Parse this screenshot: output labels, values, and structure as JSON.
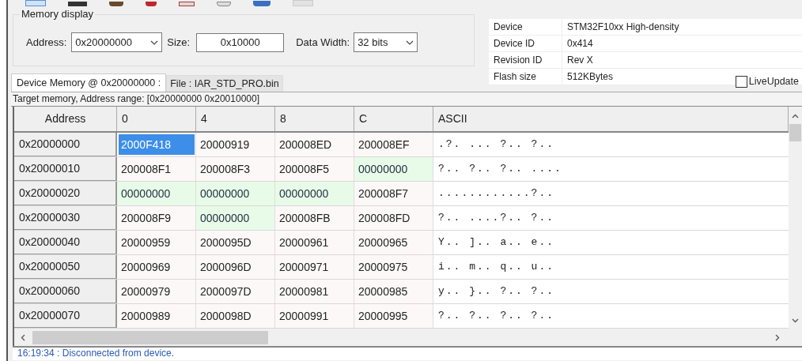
{
  "memory_display": {
    "title": "Memory display",
    "address_label": "Address:",
    "address": "0x20000000",
    "size_label": "Size:",
    "size": "0x10000",
    "data_width_label": "Data Width:",
    "data_width": "32 bits"
  },
  "device_info": [
    {
      "label": "Device",
      "value": "STM32F10xx High-density"
    },
    {
      "label": "Device ID",
      "value": "0x414"
    },
    {
      "label": "Revision ID",
      "value": "Rev X"
    },
    {
      "label": "Flash size",
      "value": "512KBytes"
    }
  ],
  "tabs": [
    {
      "label": "Device Memory @ 0x20000000 :",
      "selected": true
    },
    {
      "label": "File : IAR_STD_PRO.bin",
      "selected": false
    }
  ],
  "live_update": {
    "label": "LiveUpdate",
    "checked": false
  },
  "range_text": "Target memory, Address range: [0x20000000 0x20010000]",
  "table": {
    "header": {
      "address": "Address",
      "offsets": [
        "0",
        "4",
        "8",
        "C"
      ],
      "ascii": "ASCII"
    },
    "rows": [
      {
        "address": "0x20000000",
        "cells": [
          {
            "value": "2000F418",
            "selected": true,
            "zero": false
          },
          {
            "value": "20000919",
            "selected": false,
            "zero": false
          },
          {
            "value": "200008ED",
            "selected": false,
            "zero": false
          },
          {
            "value": "200008EF",
            "selected": false,
            "zero": false
          }
        ],
        "ascii": ".?. ... ?.. ?.."
      },
      {
        "address": "0x20000010",
        "cells": [
          {
            "value": "200008F1",
            "selected": false,
            "zero": false
          },
          {
            "value": "200008F3",
            "selected": false,
            "zero": false
          },
          {
            "value": "200008F5",
            "selected": false,
            "zero": false
          },
          {
            "value": "00000000",
            "selected": false,
            "zero": true
          }
        ],
        "ascii": "?.. ?.. ?.. ...."
      },
      {
        "address": "0x20000020",
        "cells": [
          {
            "value": "00000000",
            "selected": false,
            "zero": true
          },
          {
            "value": "00000000",
            "selected": false,
            "zero": true
          },
          {
            "value": "00000000",
            "selected": false,
            "zero": true
          },
          {
            "value": "200008F7",
            "selected": false,
            "zero": false
          }
        ],
        "ascii": "............?.."
      },
      {
        "address": "0x20000030",
        "cells": [
          {
            "value": "200008F9",
            "selected": false,
            "zero": false
          },
          {
            "value": "00000000",
            "selected": false,
            "zero": true
          },
          {
            "value": "200008FB",
            "selected": false,
            "zero": false
          },
          {
            "value": "200008FD",
            "selected": false,
            "zero": false
          }
        ],
        "ascii": "?.. ....?.. ?.."
      },
      {
        "address": "0x20000040",
        "cells": [
          {
            "value": "20000959",
            "selected": false,
            "zero": false
          },
          {
            "value": "2000095D",
            "selected": false,
            "zero": false
          },
          {
            "value": "20000961",
            "selected": false,
            "zero": false
          },
          {
            "value": "20000965",
            "selected": false,
            "zero": false
          }
        ],
        "ascii": "Y.. ].. a.. e.."
      },
      {
        "address": "0x20000050",
        "cells": [
          {
            "value": "20000969",
            "selected": false,
            "zero": false
          },
          {
            "value": "2000096D",
            "selected": false,
            "zero": false
          },
          {
            "value": "20000971",
            "selected": false,
            "zero": false
          },
          {
            "value": "20000975",
            "selected": false,
            "zero": false
          }
        ],
        "ascii": "i.. m.. q.. u.."
      },
      {
        "address": "0x20000060",
        "cells": [
          {
            "value": "20000979",
            "selected": false,
            "zero": false
          },
          {
            "value": "2000097D",
            "selected": false,
            "zero": false
          },
          {
            "value": "20000981",
            "selected": false,
            "zero": false
          },
          {
            "value": "20000985",
            "selected": false,
            "zero": false
          }
        ],
        "ascii": "y.. }.. ?.. ?.."
      },
      {
        "address": "0x20000070",
        "cells": [
          {
            "value": "20000989",
            "selected": false,
            "zero": false
          },
          {
            "value": "2000098D",
            "selected": false,
            "zero": false
          },
          {
            "value": "20000991",
            "selected": false,
            "zero": false
          },
          {
            "value": "20000995",
            "selected": false,
            "zero": false
          }
        ],
        "ascii": "?.. ?.. ?.. ?.."
      }
    ]
  },
  "log": "16:19:34 : Disconnected from device."
}
